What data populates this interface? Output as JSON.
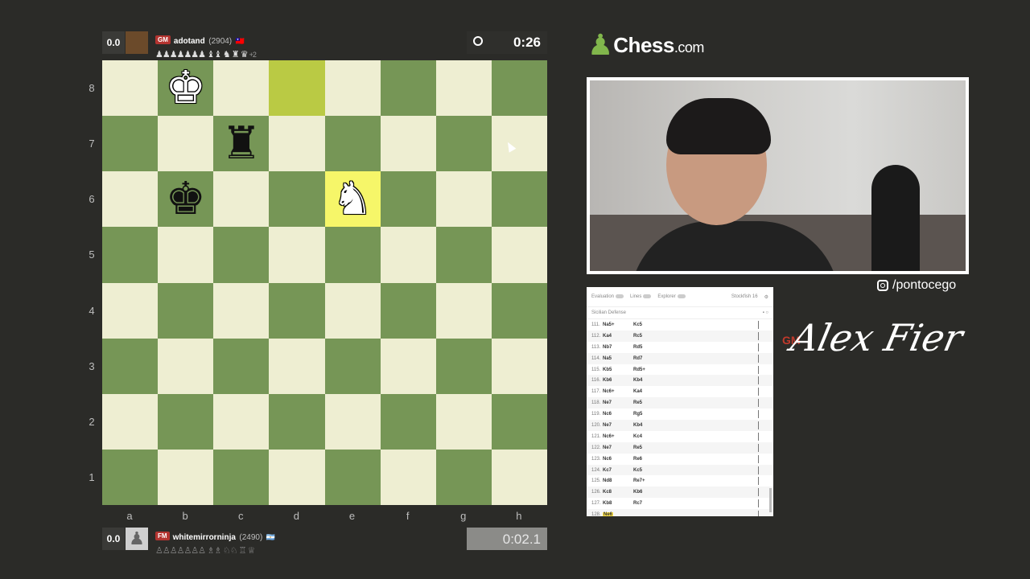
{
  "top_player": {
    "eval": "0.0",
    "title": "GM",
    "name": "adotand",
    "rating": "(2904)",
    "flag": "🇹🇼",
    "captured": "♟♟♟♟♟♟♟ ♝♝ ♞ ♜ ♛",
    "material_diff": "+2",
    "clock": "0:26",
    "clock_icon": "clock-icon"
  },
  "bottom_player": {
    "eval": "0.0",
    "title": "FM",
    "name": "whitemirrorninja",
    "rating": "(2490)",
    "flag": "🇦🇷",
    "captured": "♙♙♙♙♙♙♙ ♗♗ ♘♘ ♖ ♕",
    "clock": "0:02.1"
  },
  "board": {
    "ranks": [
      "8",
      "7",
      "6",
      "5",
      "4",
      "3",
      "2",
      "1"
    ],
    "files": [
      "a",
      "b",
      "c",
      "d",
      "e",
      "f",
      "g",
      "h"
    ],
    "light_color": "#eeeed2",
    "dark_color": "#769656",
    "highlight_squares": [
      "d8",
      "e6"
    ],
    "pieces": {
      "b8": {
        "glyph": "♚",
        "color": "white"
      },
      "c7": {
        "glyph": "♜",
        "color": "black"
      },
      "b6": {
        "glyph": "♚",
        "color": "black"
      },
      "e6": {
        "glyph": "♞",
        "color": "white"
      }
    }
  },
  "brand": {
    "name": "Chess",
    "domain": ".com"
  },
  "social": {
    "handle": "/pontocego",
    "icon": "instagram-icon"
  },
  "signature": {
    "title": "GM",
    "name": "Alex Fier"
  },
  "analysis": {
    "toggles": [
      "Evaluation",
      "Lines",
      "Explorer"
    ],
    "engine": "Stockfish 16",
    "opening": "Sicilian Defense",
    "moves": [
      {
        "n": "111.",
        "w": "Na5+",
        "b": "Kc5"
      },
      {
        "n": "112.",
        "w": "Ka4",
        "b": "Rc5"
      },
      {
        "n": "113.",
        "w": "Nb7",
        "b": "Rd5"
      },
      {
        "n": "114.",
        "w": "Na5",
        "b": "Rd7"
      },
      {
        "n": "115.",
        "w": "Kb5",
        "b": "Rd5+"
      },
      {
        "n": "116.",
        "w": "Kb6",
        "b": "Kb4"
      },
      {
        "n": "117.",
        "w": "Nc6+",
        "b": "Ka4"
      },
      {
        "n": "118.",
        "w": "Ne7",
        "b": "Re5"
      },
      {
        "n": "119.",
        "w": "Nc6",
        "b": "Rg5"
      },
      {
        "n": "120.",
        "w": "Ne7",
        "b": "Kb4"
      },
      {
        "n": "121.",
        "w": "Nc6+",
        "b": "Kc4"
      },
      {
        "n": "122.",
        "w": "Ne7",
        "b": "Re5"
      },
      {
        "n": "123.",
        "w": "Nc6",
        "b": "Re6"
      },
      {
        "n": "124.",
        "w": "Kc7",
        "b": "Kc5"
      },
      {
        "n": "125.",
        "w": "Nd8",
        "b": "Re7+"
      },
      {
        "n": "126.",
        "w": "Kc8",
        "b": "Kb6"
      },
      {
        "n": "127.",
        "w": "Kb8",
        "b": "Rc7"
      },
      {
        "n": "128.",
        "w": "Ne6",
        "b": ""
      }
    ]
  }
}
